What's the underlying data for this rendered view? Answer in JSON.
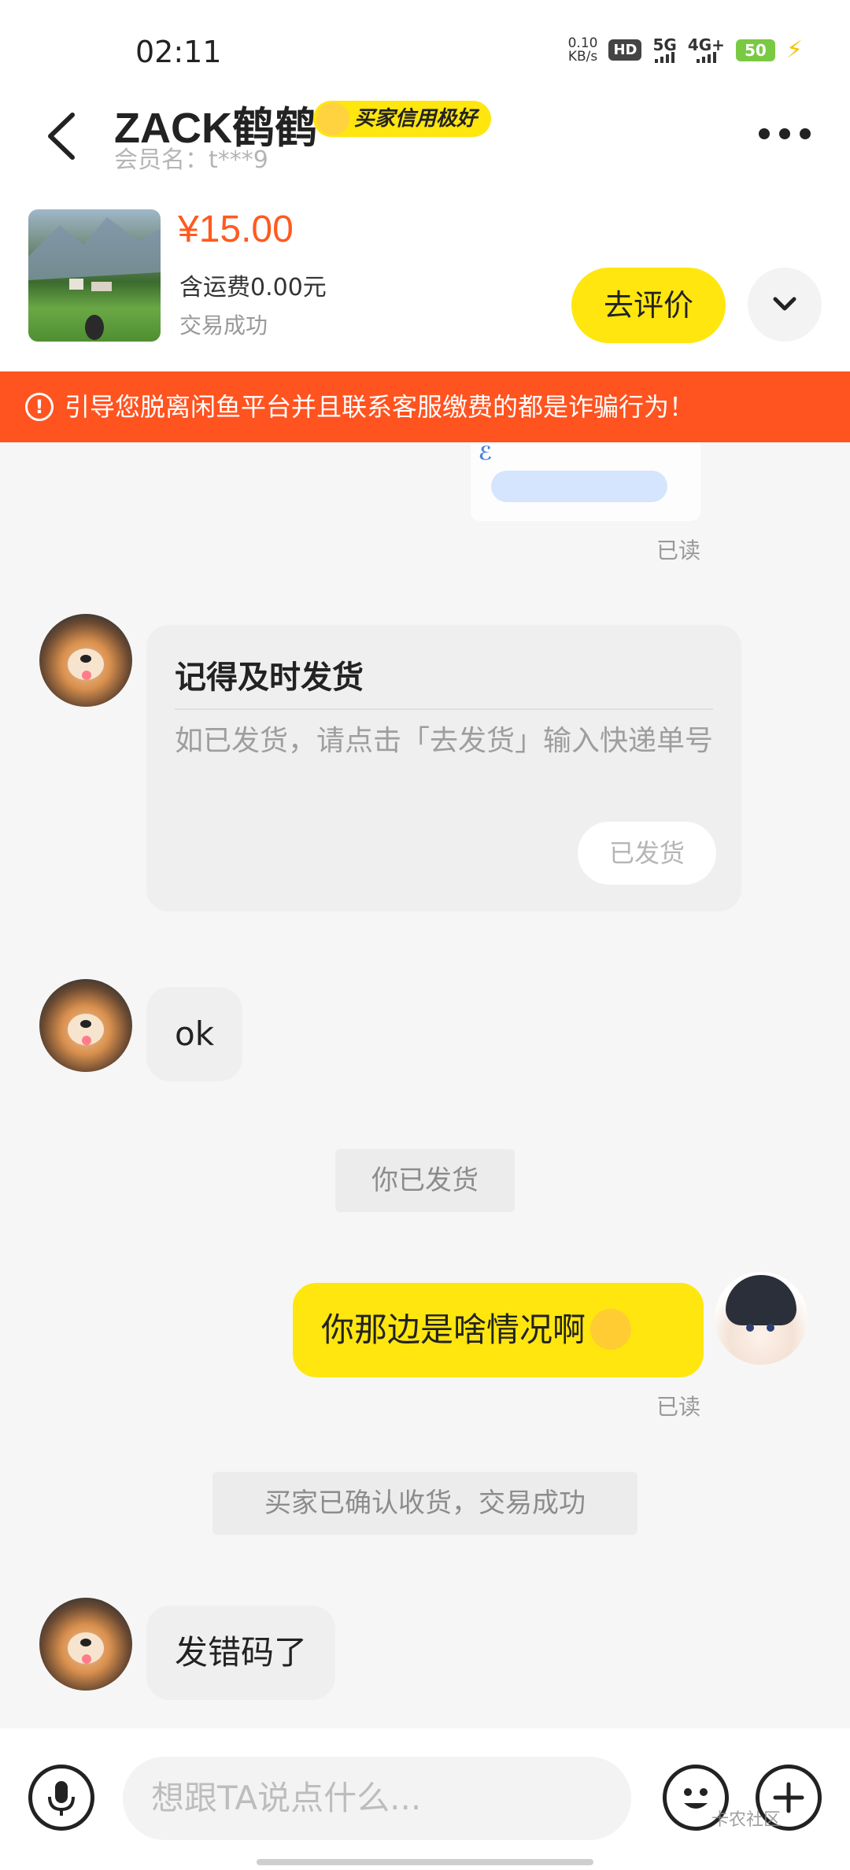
{
  "status_bar": {
    "time": "02:11",
    "net_speed": "0.10",
    "net_speed_unit": "KB/s",
    "hd_label": "HD",
    "net1": "5G",
    "net2": "4G+",
    "battery": "50"
  },
  "header": {
    "title": "ZACK鹤鹤",
    "badge": "买家信用极好",
    "member_label": "会员名：t***9"
  },
  "product": {
    "price": "¥15.00",
    "shipping": "含运费0.00元",
    "status": "交易成功",
    "review_button": "去评价"
  },
  "warning": {
    "text": "引导您脱离闲鱼平台并且联系客服缴费的都是诈骗行为！"
  },
  "chat": {
    "read_label": "已读",
    "reminder_card": {
      "title": "记得及时发货",
      "body": "如已发货，请点击「去发货」输入快递单号",
      "button": "已发货"
    },
    "msg_ok": "ok",
    "sys_shipped": "你已发货",
    "msg_mine": "你那边是啥情况啊",
    "sys_confirmed": "买家已确认收货，交易成功",
    "msg_wrong_code": "发错码了"
  },
  "input_bar": {
    "placeholder": "想跟TA说点什么..."
  },
  "watermark": "卡农社区",
  "colors": {
    "accent_yellow": "#ffe60f",
    "warning_orange": "#ff5320",
    "price_orange": "#ff5a1f"
  }
}
